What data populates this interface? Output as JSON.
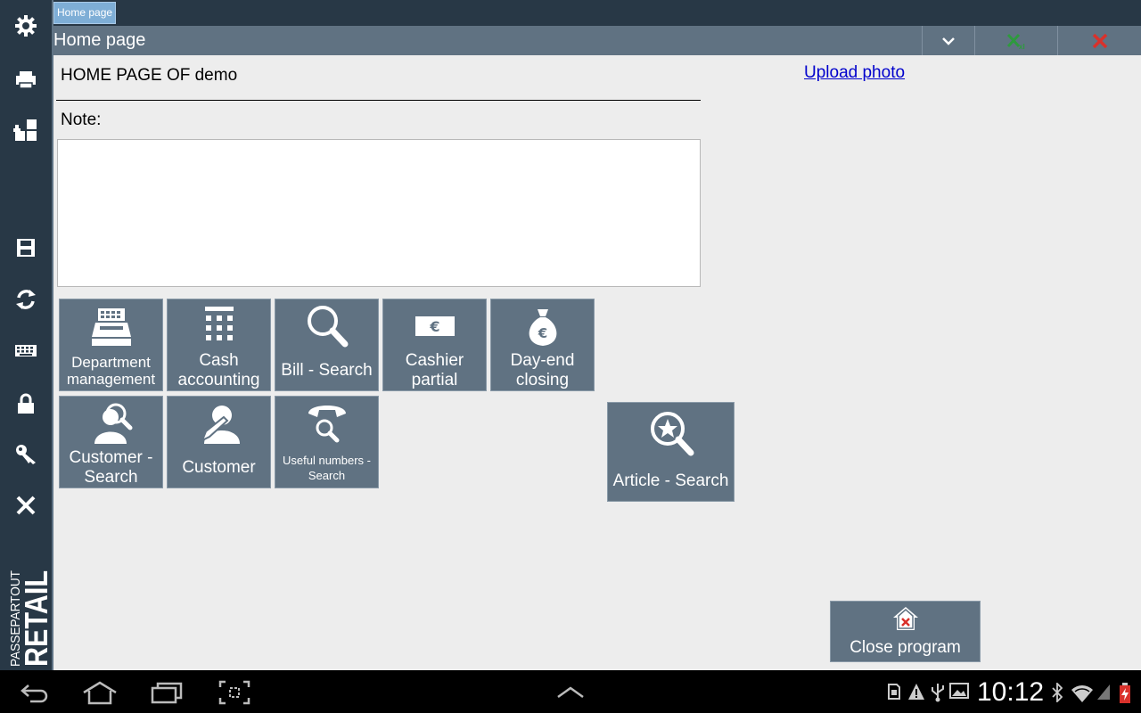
{
  "colors": {
    "sidebar": "#283846",
    "titlebar": "#607282",
    "tile": "#607282",
    "content_bg": "#ededed",
    "tab_active": "#7eaed6",
    "link": "#0000cc",
    "excel_green": "#2e9a3e",
    "close_red": "#d9312b"
  },
  "sidebar": {
    "items": [
      {
        "icon": "gear-icon"
      },
      {
        "icon": "printer-icon"
      },
      {
        "icon": "add-dashboard-icon"
      },
      {
        "icon": "save-icon"
      },
      {
        "icon": "refresh-icon"
      },
      {
        "icon": "keyboard-icon"
      },
      {
        "icon": "lock-icon"
      },
      {
        "icon": "key-icon"
      },
      {
        "icon": "close-icon"
      }
    ],
    "brand_top": "PASSEPARTOUT",
    "brand_bottom": "RETAIL"
  },
  "tabs": [
    {
      "label": "Home page",
      "active": true
    }
  ],
  "titlebar": {
    "title": "Home page"
  },
  "main": {
    "heading": "HOME PAGE OF demo",
    "note_label": "Note:",
    "note_value": "",
    "upload_photo": "Upload photo"
  },
  "tiles": [
    {
      "label": "Department management",
      "icon": "cash-register-icon"
    },
    {
      "label": "Cash accounting",
      "icon": "calculator-icon"
    },
    {
      "label": "Bill - Search",
      "icon": "magnifier-icon"
    },
    {
      "label": "Cashier partial",
      "icon": "euro-banknote-icon"
    },
    {
      "label": "Day-end closing",
      "icon": "money-bag-icon"
    },
    {
      "label": "Customer - Search",
      "icon": "customer-search-icon"
    },
    {
      "label": "Customer",
      "icon": "customer-edit-icon"
    },
    {
      "label": "Useful numbers - Search",
      "icon": "phone-search-icon"
    },
    {
      "label": "Article - Search",
      "icon": "star-search-icon"
    },
    {
      "label": "Close program",
      "icon": "home-close-icon"
    }
  ],
  "statusbar": {
    "time": "10:12"
  }
}
